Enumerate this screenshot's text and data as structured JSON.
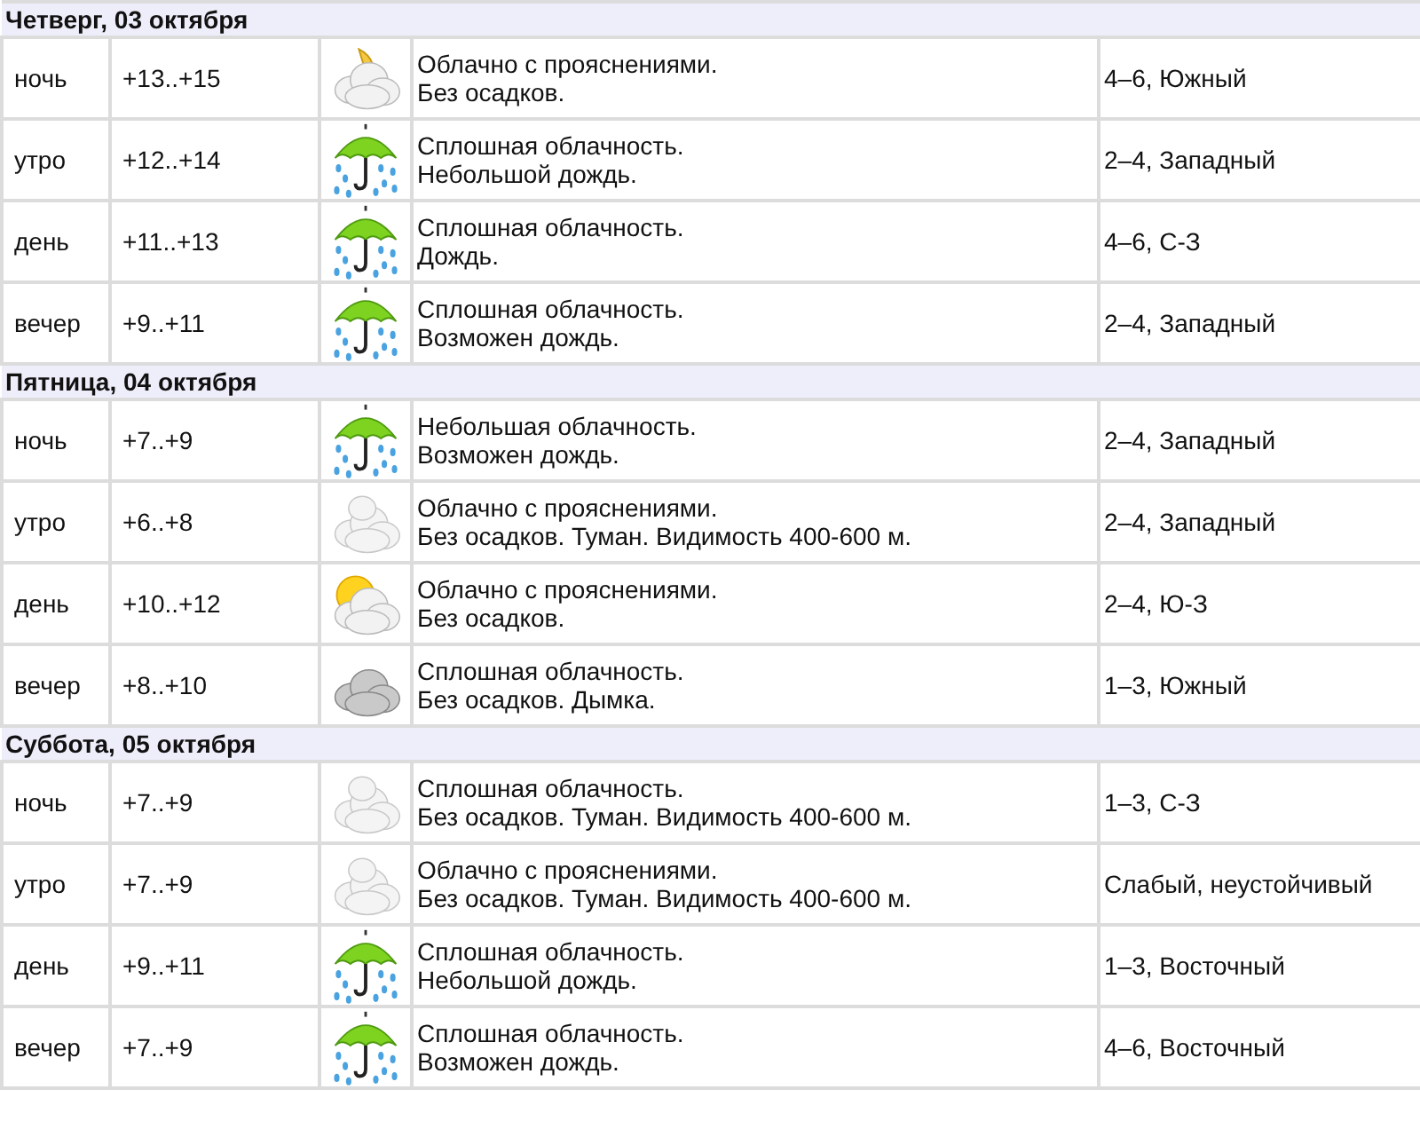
{
  "days": [
    {
      "date": "Четверг, 03 октября",
      "periods": [
        {
          "period": "ночь",
          "temp": "+13..+15",
          "kind": "moon_cloud",
          "sky": "Облачно с прояснениями.",
          "precipitation": "Без осадков.",
          "wind": "4–6, Южный"
        },
        {
          "period": "утро",
          "temp": "+12..+14",
          "kind": "rain",
          "sky": "Сплошная облачность.",
          "precipitation": "Небольшой дождь.",
          "wind": "2–4, Западный"
        },
        {
          "period": "день",
          "temp": "+11..+13",
          "kind": "rain",
          "sky": "Сплошная облачность.",
          "precipitation": "Дождь.",
          "wind": "4–6, С-З"
        },
        {
          "period": "вечер",
          "temp": "+9..+11",
          "kind": "rain",
          "sky": "Сплошная облачность.",
          "precipitation": "Возможен дождь.",
          "wind": "2–4, Западный"
        }
      ]
    },
    {
      "date": "Пятница, 04 октября",
      "periods": [
        {
          "period": "ночь",
          "temp": "+7..+9",
          "kind": "rain",
          "sky": "Небольшая облачность.",
          "precipitation": "Возможен дождь.",
          "wind": "2–4, Западный"
        },
        {
          "period": "утро",
          "temp": "+6..+8",
          "kind": "cloud",
          "sky": "Облачно с прояснениями.",
          "precipitation": "Без осадков. Туман. Видимость 400-600 м.",
          "wind": "2–4, Западный"
        },
        {
          "period": "день",
          "temp": "+10..+12",
          "kind": "sun_cloud",
          "sky": "Облачно с прояснениями.",
          "precipitation": "Без осадков.",
          "wind": "2–4, Ю-З"
        },
        {
          "period": "вечер",
          "temp": "+8..+10",
          "kind": "overcast",
          "sky": "Сплошная облачность.",
          "precipitation": "Без осадков. Дымка.",
          "wind": "1–3, Южный"
        }
      ]
    },
    {
      "date": "Суббота, 05 октября",
      "periods": [
        {
          "period": "ночь",
          "temp": "+7..+9",
          "kind": "cloud",
          "sky": "Сплошная облачность.",
          "precipitation": "Без осадков. Туман. Видимость 400-600 м.",
          "wind": "1–3, С-З"
        },
        {
          "period": "утро",
          "temp": "+7..+9",
          "kind": "cloud",
          "sky": "Облачно с прояснениями.",
          "precipitation": "Без осадков. Туман. Видимость 400-600 м.",
          "wind": "Слабый, неустойчивый"
        },
        {
          "period": "день",
          "temp": "+9..+11",
          "kind": "rain",
          "sky": "Сплошная облачность.",
          "precipitation": "Небольшой дождь.",
          "wind": "1–3, Восточный"
        },
        {
          "period": "вечер",
          "temp": "+7..+9",
          "kind": "rain",
          "sky": "Сплошная облачность.",
          "precipitation": "Возможен дождь.",
          "wind": "4–6, Восточный"
        }
      ]
    }
  ]
}
